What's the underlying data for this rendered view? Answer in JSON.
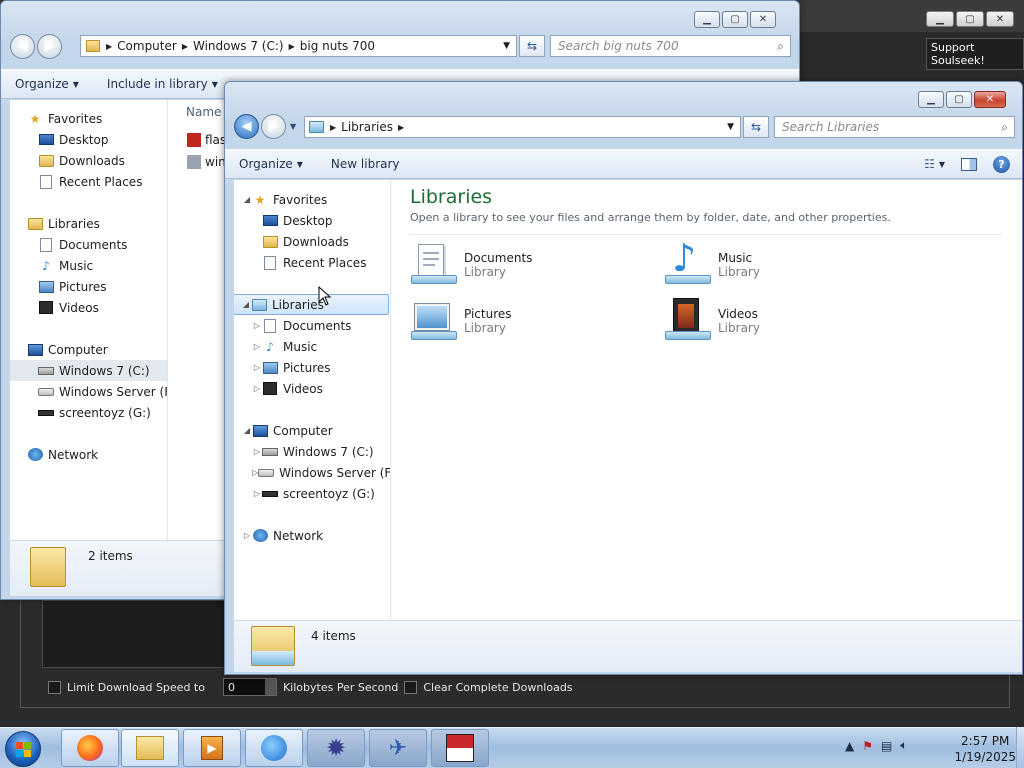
{
  "soulseek": {
    "support_label": "Support Soulseek!",
    "limit_label": "Limit Download Speed to",
    "limit_value": "0",
    "unit_label": "Kilobytes Per Second",
    "clear_label": "Clear Complete Downloads"
  },
  "back_explorer": {
    "address": [
      "Computer",
      "Windows 7 (C:)",
      "big nuts 700"
    ],
    "search_placeholder": "Search big nuts 700",
    "commands": [
      "Organize",
      "Include in library"
    ],
    "column_name": "Name",
    "files": [
      "flas",
      "win"
    ],
    "nav": {
      "favorites": "Favorites",
      "favorites_items": [
        "Desktop",
        "Downloads",
        "Recent Places"
      ],
      "libraries": "Libraries",
      "libraries_items": [
        "Documents",
        "Music",
        "Pictures",
        "Videos"
      ],
      "computer": "Computer",
      "computer_items": [
        "Windows 7 (C:)",
        "Windows Server (F:)",
        "screentoyz (G:)"
      ],
      "network": "Network"
    },
    "status": "2 items"
  },
  "front_explorer": {
    "address": [
      "Libraries"
    ],
    "search_placeholder": "Search Libraries",
    "commands": [
      "Organize",
      "New library"
    ],
    "nav": {
      "favorites": "Favorites",
      "favorites_items": [
        "Desktop",
        "Downloads",
        "Recent Places"
      ],
      "libraries": "Libraries",
      "libraries_items": [
        "Documents",
        "Music",
        "Pictures",
        "Videos"
      ],
      "computer": "Computer",
      "computer_items": [
        "Windows 7 (C:)",
        "Windows Server (F:)",
        "screentoyz (G:)"
      ],
      "network": "Network"
    },
    "heading": "Libraries",
    "subheading": "Open a library to see your files and arrange them by folder, date, and other properties.",
    "tiles": [
      {
        "name": "Documents",
        "type": "Library"
      },
      {
        "name": "Music",
        "type": "Library"
      },
      {
        "name": "Pictures",
        "type": "Library"
      },
      {
        "name": "Videos",
        "type": "Library"
      }
    ],
    "status": "4 items"
  },
  "taskbar": {
    "time": "2:57 PM",
    "date": "1/19/2025"
  },
  "colors": {
    "accent_heading": "#1e6b37",
    "selection": "#cfe4fa",
    "taskbar": "#a8c4e5"
  }
}
